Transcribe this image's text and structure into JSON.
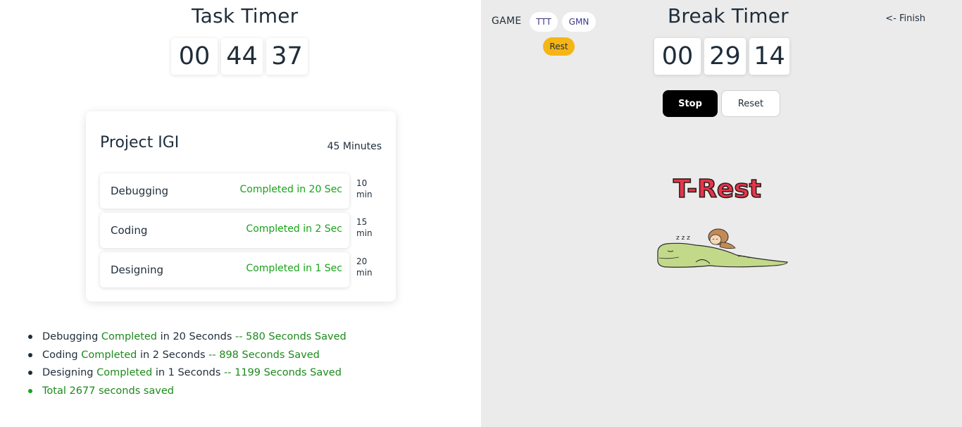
{
  "task_timer": {
    "title": "Task Timer",
    "hours": "00",
    "minutes": "44",
    "seconds": "37"
  },
  "project": {
    "title": "Project IGI",
    "duration": "45 Minutes",
    "tasks": [
      {
        "name": "Debugging",
        "status": "Completed in 20 Sec",
        "min_value": "10",
        "min_unit": "min"
      },
      {
        "name": "Coding",
        "status": "Completed in 2 Sec",
        "min_value": "15",
        "min_unit": "min"
      },
      {
        "name": "Designing",
        "status": "Completed in 1 Sec",
        "min_value": "20",
        "min_unit": "min"
      }
    ]
  },
  "summary": {
    "items": [
      {
        "task": "Debugging",
        "completed": "Completed",
        "duration": "in 20 Seconds",
        "saved": "-- 580 Seconds Saved"
      },
      {
        "task": "Coding",
        "completed": "Completed",
        "duration": "in 2 Seconds",
        "saved": "-- 898 Seconds Saved"
      },
      {
        "task": "Designing",
        "completed": "Completed",
        "duration": "in 1 Seconds",
        "saved": "-- 1199 Seconds Saved"
      }
    ],
    "total": "Total 2677 seconds saved"
  },
  "break_panel": {
    "game_label": "GAME",
    "game_buttons": [
      "TTT",
      "GMN"
    ],
    "rest_label": "Rest",
    "finish_label": "<- Finish",
    "title": "Break Timer",
    "hours": "00",
    "minutes": "29",
    "seconds": "14",
    "stop_label": "Stop",
    "reset_label": "Reset",
    "illustration_text": "T-Rest",
    "zzz": "z z z"
  },
  "colors": {
    "left_bg": "#ffffff",
    "right_bg": "#ebebeb",
    "completed_green": "#1aa31a",
    "rest_yellow": "#f5b514",
    "trest_red": "#e8344a",
    "dino_green": "#c3d98a",
    "text_dark": "#1f2d3a"
  }
}
